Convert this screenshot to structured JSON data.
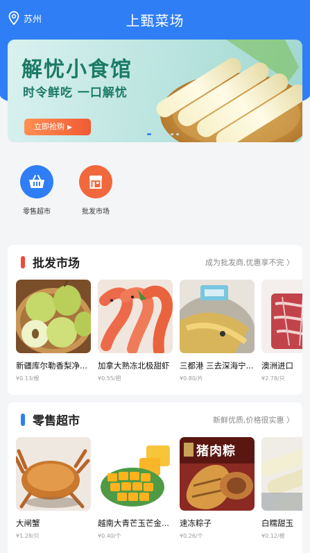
{
  "header": {
    "location": "苏州",
    "title": "上甄菜场"
  },
  "banner": {
    "title": "解忧小食馆",
    "subtitle": "时令鲜吃 一口解忧",
    "button": "立即抢购",
    "slide_count": 6,
    "active_slide": 0
  },
  "quick_links": [
    {
      "label": "零售超市",
      "icon": "shopping-basket-icon",
      "color": "#2f7ef5"
    },
    {
      "label": "批发市场",
      "icon": "store-icon",
      "color": "#f0683c"
    }
  ],
  "wholesale": {
    "title": "批发市场",
    "hint": "成为批发商,优惠享不完",
    "accent": "#f04a3a",
    "items": [
      {
        "name": "新疆库尔勒香梨净...",
        "price": "¥0.13/根",
        "image": "pear-image"
      },
      {
        "name": "加拿大熟冻北极甜虾",
        "price": "¥0.55/把",
        "image": "shrimp-image"
      },
      {
        "name": "三都港 三去深海宁...",
        "price": "¥0.80/片",
        "image": "croaker-fish-image"
      },
      {
        "name": "澳洲进口",
        "price": "¥2.78/只",
        "image": "beef-image"
      }
    ]
  },
  "retail": {
    "title": "零售超市",
    "hint": "新鲜优质,价格很实惠",
    "accent": "#2f7ef5",
    "items": [
      {
        "name": "大闸蟹",
        "price": "¥1.28/只",
        "image": "crab-image"
      },
      {
        "name": "越南大青芒玉芒金...",
        "price": "¥0.40/个",
        "image": "mango-image"
      },
      {
        "name": "速冻粽子",
        "price": "¥0.26/个",
        "image": "zongzi-image",
        "package_text": "猪肉粽"
      },
      {
        "name": "白糯甜玉",
        "price": "¥0.12/根",
        "image": "corn-image"
      }
    ]
  }
}
